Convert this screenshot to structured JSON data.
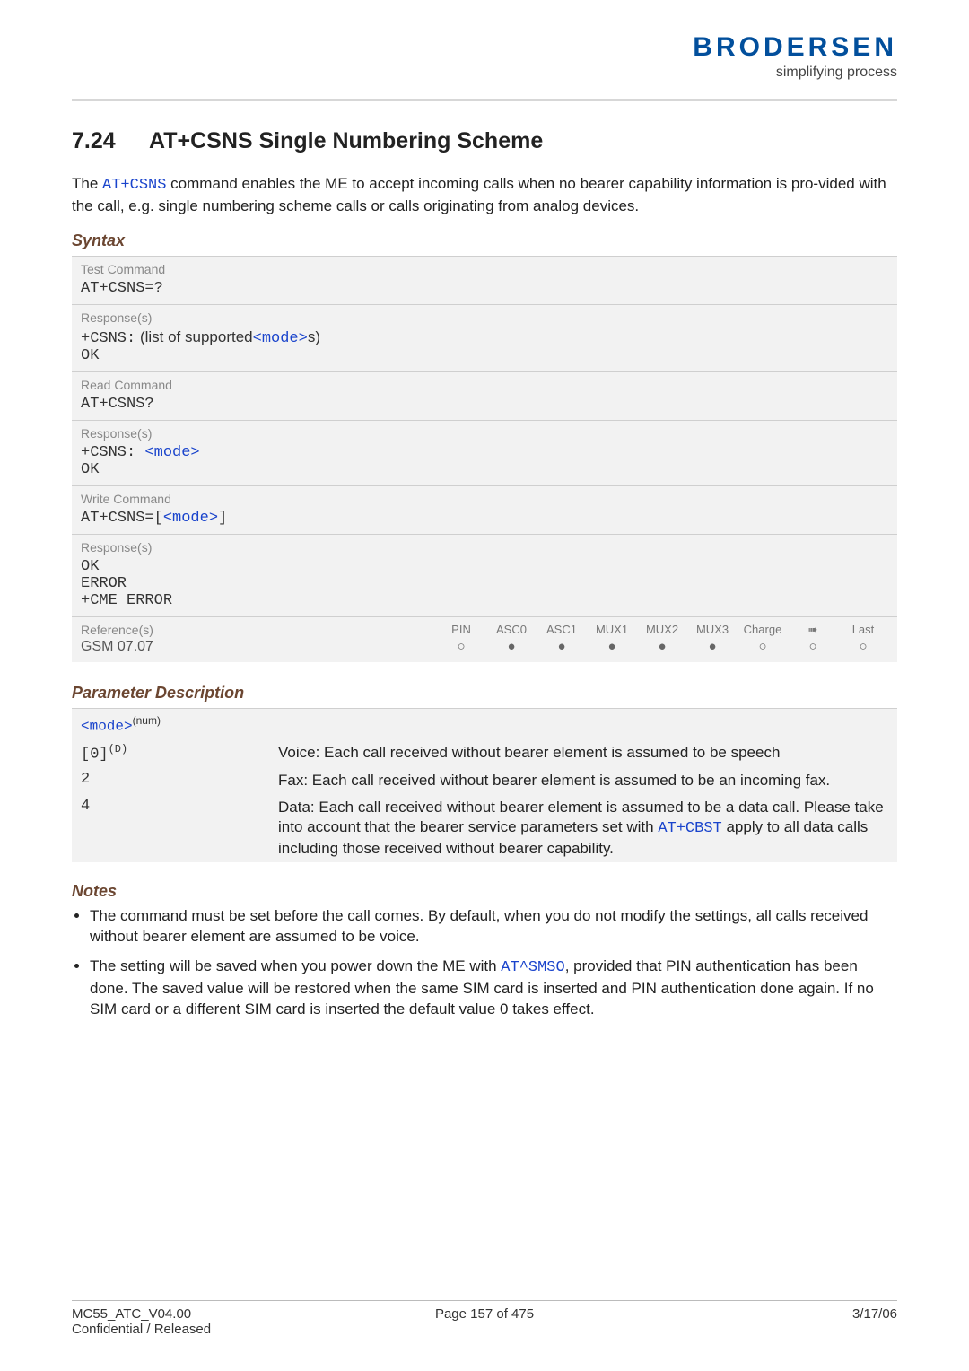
{
  "brand": {
    "logo": "BRODERSEN",
    "tagline": "simplifying process"
  },
  "section": {
    "number": "7.24",
    "title": "AT+CSNS   Single Numbering Scheme"
  },
  "intro": {
    "p1a": "The ",
    "cmd": "AT+CSNS",
    "p1b": " command enables the ME to accept incoming calls when no bearer capability information is pro-vided with the call, e.g. single numbering scheme calls or calls originating from analog devices."
  },
  "syntax_label": "Syntax",
  "blocks": {
    "test_label": "Test Command",
    "test_cmd": "AT+CSNS=?",
    "resp_label": "Response(s)",
    "test_resp_a": "+CSNS:",
    "test_resp_b": " (list of supported",
    "mode": "<mode>",
    "test_resp_c": "s)",
    "ok": "OK",
    "read_label": "Read Command",
    "read_cmd": "AT+CSNS?",
    "read_resp_a": "+CSNS: ",
    "write_label": "Write Command",
    "write_cmd_a": "AT+CSNS=",
    "write_cmd_b": "[",
    "write_cmd_c": "]",
    "error": "ERROR",
    "cme": "+CME ERROR",
    "ref_label": "Reference(s)",
    "cols": {
      "c1": "PIN",
      "c2": "ASC0",
      "c3": "ASC1",
      "c4": "MUX1",
      "c5": "MUX2",
      "c6": "MUX3",
      "c7": "Charge",
      "c8": "➠",
      "c9": "Last"
    },
    "refval": "GSM 07.07",
    "dots": {
      "d1": "○",
      "d2": "●",
      "d3": "●",
      "d4": "●",
      "d5": "●",
      "d6": "●",
      "d7": "○",
      "d8": "○",
      "d9": "○"
    }
  },
  "param_label": "Parameter Description",
  "param_head": "<mode>",
  "param_head_sup": "(num)",
  "params": {
    "r1k": "[0]",
    "r1sup": "(D)",
    "r1v": "Voice: Each call received without bearer element is assumed to be speech",
    "r2k": "2",
    "r2v": "Fax: Each call received without bearer element is assumed to be an incoming fax.",
    "r3k": "4",
    "r3va": "Data: Each call received without bearer element is assumed to be a data call. Please take into account that the bearer service parameters set with ",
    "r3cmd": "AT+CBST",
    "r3vb": " apply to all data calls including those received without bearer capability."
  },
  "notes_label": "Notes",
  "notes": {
    "n1": "The command must be set before the call comes. By default, when you do not modify the settings, all calls received without bearer element are assumed to be voice.",
    "n2a": "The setting will be saved when you power down the ME with ",
    "n2cmd": "AT^SMSO",
    "n2b": ", provided that PIN authentication has been done. The saved value will be restored when the same SIM card is inserted and PIN authentication done again. If no SIM card or a different SIM card is inserted the default value 0 takes effect."
  },
  "footer": {
    "doc": "MC55_ATC_V04.00",
    "conf": "Confidential / Released",
    "page": "Page 157 of 475",
    "date": "3/17/06"
  }
}
